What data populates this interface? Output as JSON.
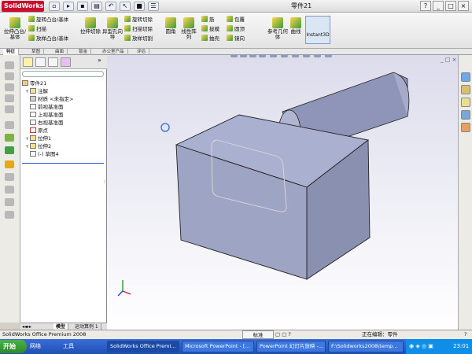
{
  "app": {
    "name": "SolidWorks",
    "doc_title": "零件21"
  },
  "commands": {
    "extrude_boss": "拉伸凸台/基体",
    "revolve_boss": "旋转凸台/基体",
    "sweep": "扫描",
    "loft_boss": "放样凸台/基体",
    "extrude_cut": "拉伸切除",
    "hole_wizard": "异型孔向导",
    "revolve_cut": "旋转切除",
    "sweep_cut": "扫描切除",
    "loft_cut": "放样切割",
    "fillet": "圆角",
    "linear_pattern": "线性阵列",
    "rib": "筋",
    "draft": "拔模",
    "shell": "抽壳",
    "wrap": "包覆",
    "dome": "圆顶",
    "mirror": "镜向",
    "ref_geometry": "参考几何体",
    "curves": "曲线",
    "instant3d": "Instant3D"
  },
  "tabs": [
    "特征",
    "草图",
    "曲面",
    "钣金",
    "办公室产品",
    "评估"
  ],
  "tree": {
    "root": "零件21",
    "items": [
      {
        "label": "注解",
        "expand": "+"
      },
      {
        "label": "材质 <未指定>",
        "expand": ""
      },
      {
        "label": "前视基准面",
        "expand": ""
      },
      {
        "label": "上视基准面",
        "expand": ""
      },
      {
        "label": "右视基准面",
        "expand": ""
      },
      {
        "label": "原点",
        "expand": ""
      },
      {
        "label": "拉伸1",
        "expand": "+"
      },
      {
        "label": "拉伸2",
        "expand": "+"
      },
      {
        "label": "(-) 草图4",
        "expand": ""
      }
    ]
  },
  "bottom_tabs": [
    "模型",
    "运动算例 1"
  ],
  "status": {
    "left": "SolidWorks Office Premium 2008",
    "units_btn": "标准",
    "editing": "正在编辑：零件"
  },
  "taskbar": {
    "start": "开始",
    "network": "网络",
    "tools": "工具",
    "tasks": [
      "SolidWorks Office Premi...",
      "Microsoft PowerPoint - [...",
      "PowerPoint 幻灯片放映 -...",
      "F:\\Solidworks2008\\temp..."
    ],
    "clock": "23:01"
  },
  "colors": {
    "titlebar": "#e8e8e8",
    "viewport_top": "#dcdcec",
    "model": "#9aa0c0",
    "taskbar": "#245edb"
  }
}
